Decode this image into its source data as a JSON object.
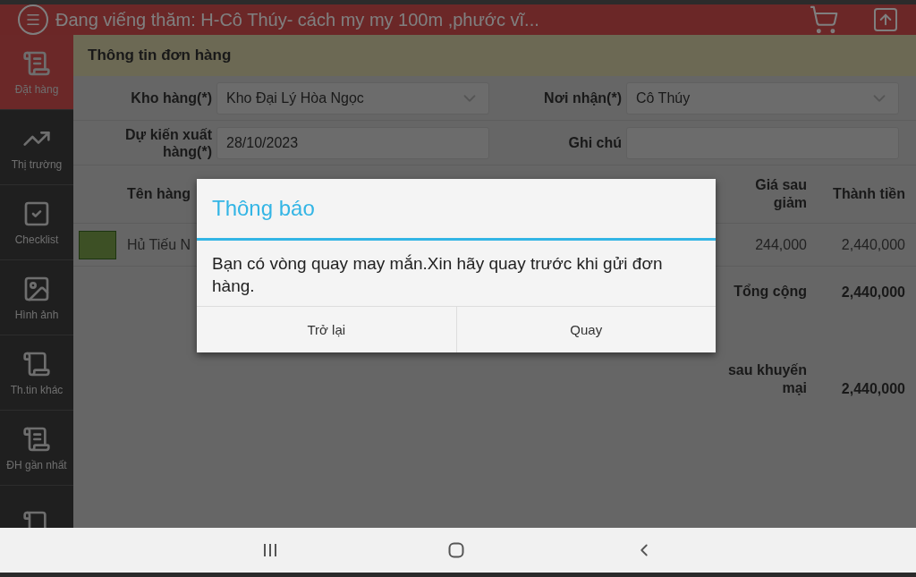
{
  "header": {
    "title": "Đang viếng thăm: H-Cô Thúy- cách my my 100m ,phước vĩ..."
  },
  "sidebar": {
    "items": [
      {
        "kind": "receipt",
        "label": "Đặt hàng",
        "selected": true
      },
      {
        "kind": "chart",
        "label": "Thị trường",
        "selected": false
      },
      {
        "kind": "check",
        "label": "Checklist",
        "selected": false
      },
      {
        "kind": "image",
        "label": "Hình ảnh",
        "selected": false
      },
      {
        "kind": "scroll",
        "label": "Th.tin khác",
        "selected": false
      },
      {
        "kind": "receipt",
        "label": "ĐH gần nhất",
        "selected": false
      },
      {
        "kind": "scroll",
        "selected": false
      }
    ]
  },
  "section": {
    "title": "Thông tin đơn hàng"
  },
  "form": {
    "rows": [
      [
        {
          "label": "Kho hàng(*)",
          "value": "Kho Đại Lý Hòa Ngọc",
          "kind": "dropdown"
        },
        {
          "label": "Nơi nhận(*)",
          "value": "Cô Thúy",
          "kind": "dropdown"
        }
      ],
      [
        {
          "label": "Dự kiến xuất hàng(*)",
          "value": "28/10/2023",
          "kind": "text"
        },
        {
          "label": "Ghi chú",
          "kind": "text"
        }
      ]
    ]
  },
  "table": {
    "columns": [
      "Tên hàng",
      "Giá sau giảm",
      "Thành tiền"
    ],
    "rows": [
      {
        "name": "Hủ Tiếu N",
        "price": "244,000",
        "total": "2,440,000"
      }
    ],
    "totals": [
      {
        "label": "Tổng cộng",
        "value": "2,440,000"
      },
      {
        "label": "sau khuyến mại",
        "value": "2,440,000"
      }
    ]
  },
  "dialog": {
    "title": "Thông báo",
    "message": "Bạn có vòng quay may mắn.Xin hãy quay trước khi gửi đơn hàng.",
    "buttons": [
      "Trở lại",
      "Quay"
    ]
  }
}
